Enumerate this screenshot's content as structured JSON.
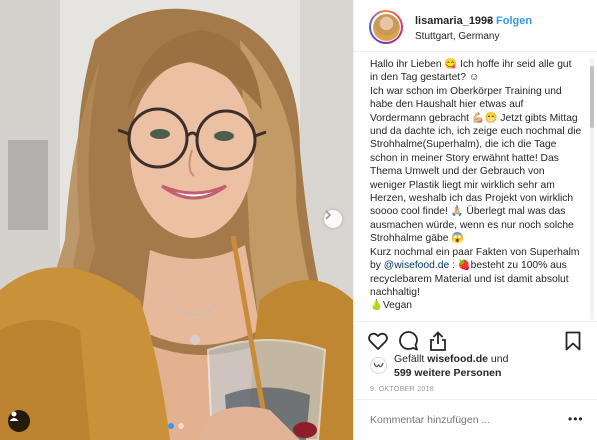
{
  "post": {
    "username": "lisamaria_1993",
    "separator": "•",
    "follow_label": "Folgen",
    "location": "Stuttgart, Germany",
    "caption": [
      "Hallo ihr Lieben 😋 Ich hoffe ihr seid alle gut in den Tag gestartet? ☺",
      "Ich war schon im Oberkörper Training und habe den Haushalt hier etwas auf Vordermann gebracht 💪🏼😁 Jetzt gibts Mittag und da dachte ich, ich zeige euch nochmal die Strohhalme(Superhalm), die ich die Tage schon in meiner Story erwähnt hatte! Das Thema Umwelt und der Gebrauch von weniger Plastik liegt mir wirklich sehr am Herzen, weshalb ich das Projekt von wirklich soooo cool finde! 🙏🏼 Überlegt mal was das ausmachen würde, wenn es nur noch solche Strohhalme gäbe 😱",
      "Kurz nochmal ein paar Fakten von Superhalm by",
      "@wisefood.de",
      ": 🍓besteht zu 100% aus recyclebarem Material und ist damit absolut nachhaltig!",
      "🍐Vegan"
    ],
    "likes_line1": "Gefällt",
    "likes_user": "wisefood.de",
    "likes_and": "und",
    "likes_line2": "599 weitere Personen",
    "date": "9. OKTOBER 2018",
    "comment_placeholder": "Kommentar hinzufügen ...",
    "more_label": "•••"
  },
  "icons": {
    "like": "heart-icon",
    "comment": "comment-icon",
    "share": "share-icon",
    "save": "bookmark-icon",
    "next": "chevron-right-icon",
    "tag": "user-tag-icon"
  },
  "colors": {
    "accent": "#3897f0",
    "mention": "#003569",
    "muted": "#999999",
    "divider": "#efefef"
  }
}
